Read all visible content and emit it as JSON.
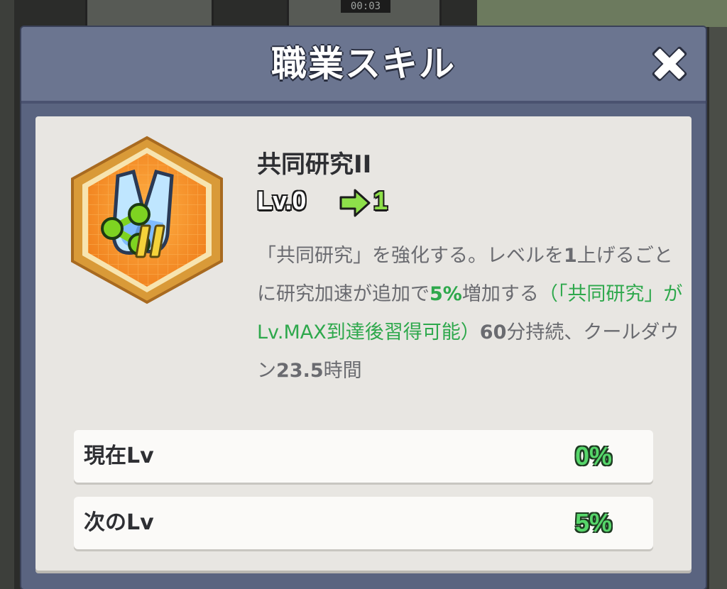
{
  "background": {
    "timer": "00:03"
  },
  "modal": {
    "title": "職業スキル",
    "close_icon": "close-icon"
  },
  "skill": {
    "icon": "flask-share-icon",
    "name": "共同研究II",
    "level_from": "Lv.0",
    "level_to": "1",
    "description": {
      "part1": "「共同研究」を強化する。レベルを",
      "part1_num": "1",
      "part2": "上げるごとに研究加速が追加で",
      "part2_hl": "5%",
      "part3": "増加する",
      "condition": "（「共同研究」がLv.MAX到達後習得可能）",
      "part4_num": "60",
      "part4": "分持続、クールダウン",
      "part5_num": "23.5",
      "part5": "時間"
    }
  },
  "stats": [
    {
      "label": "現在Lv",
      "value": "0%"
    },
    {
      "label": "次のLv",
      "value": "5%"
    }
  ],
  "colors": {
    "accent_green": "#2ea84c",
    "value_green": "#56d66a",
    "header": "#6b7590",
    "panel": "#e8e6e2",
    "icon_orange": "#f29a2e"
  }
}
